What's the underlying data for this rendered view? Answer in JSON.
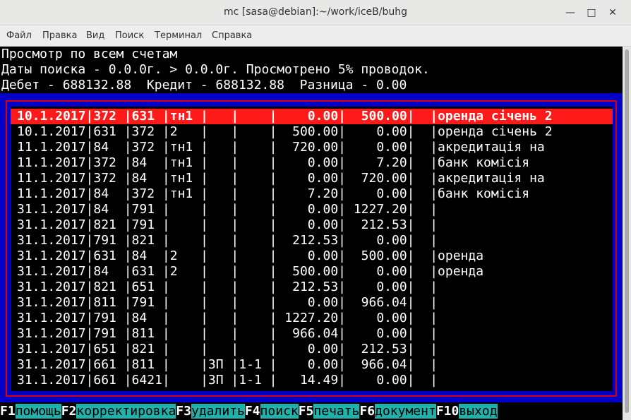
{
  "window": {
    "title": "mc [sasa@debian]:~/work/iceB/buhg"
  },
  "menu": [
    "Файл",
    "Правка",
    "Вид",
    "Поиск",
    "Терминал",
    "Справка"
  ],
  "header": {
    "line1": "Просмотр по всем счетам",
    "line2": "Даты поиска - 0.0.0г. > 0.0.0г. Просмотрено 5% проводок.",
    "line3": "Дебет - 688132.88  Кредит - 688132.88  Разница - 0.00"
  },
  "rows": [
    "10.1.2017|372 |631 |тн1 |   |    |    0.00|  500.00|  |оренда січень 2",
    "10.1.2017|631 |372 |2   |   |    |  500.00|    0.00|  |оренда січень 2",
    "11.1.2017|84  |372 |тн1 |   |    |  720.00|    0.00|  |акредитація на",
    "11.1.2017|372 |84  |тн1 |   |    |    0.00|    7.20|  |банк комісія",
    "11.1.2017|372 |84  |тн1 |   |    |    0.00|  720.00|  |акредитація на",
    "11.1.2017|84  |372 |тн1 |   |    |    7.20|    0.00|  |банк комісія",
    "31.1.2017|84  |791 |    |   |    |    0.00| 1227.20|  |",
    "31.1.2017|821 |791 |    |   |    |    0.00|  212.53|  |",
    "31.1.2017|791 |821 |    |   |    |  212.53|    0.00|  |",
    "31.1.2017|631 |84  |2   |   |    |    0.00|  500.00|  |оренда",
    "31.1.2017|84  |631 |2   |   |    |  500.00|    0.00|  |оренда",
    "31.1.2017|821 |651 |    |   |    |  212.53|    0.00|  |",
    "31.1.2017|811 |791 |    |   |    |    0.00|  966.04|  |",
    "31.1.2017|791 |84  |    |   |    | 1227.20|    0.00|  |",
    "31.1.2017|791 |811 |    |   |    |  966.04|    0.00|  |",
    "31.1.2017|651 |821 |    |   |    |    0.00|  212.53|  |",
    "31.1.2017|661 |811 |    |ЗП |1-1 |    0.00|  966.04|  |",
    "31.1.2017|661 |6421|    |ЗП |1-1 |   14.49|    0.00|  |"
  ],
  "fkeys": [
    {
      "key": "F1",
      "label": "помощь"
    },
    {
      "key": "F2",
      "label": "корректировка"
    },
    {
      "key": "F3",
      "label": "удалить"
    },
    {
      "key": "F4",
      "label": "поиск"
    },
    {
      "key": "F5",
      "label": "печать"
    },
    {
      "key": "F6",
      "label": "документ"
    },
    {
      "key": "F10",
      "label": "выход"
    }
  ],
  "window_controls": [
    "minimize-icon",
    "maximize-icon",
    "close-icon"
  ]
}
